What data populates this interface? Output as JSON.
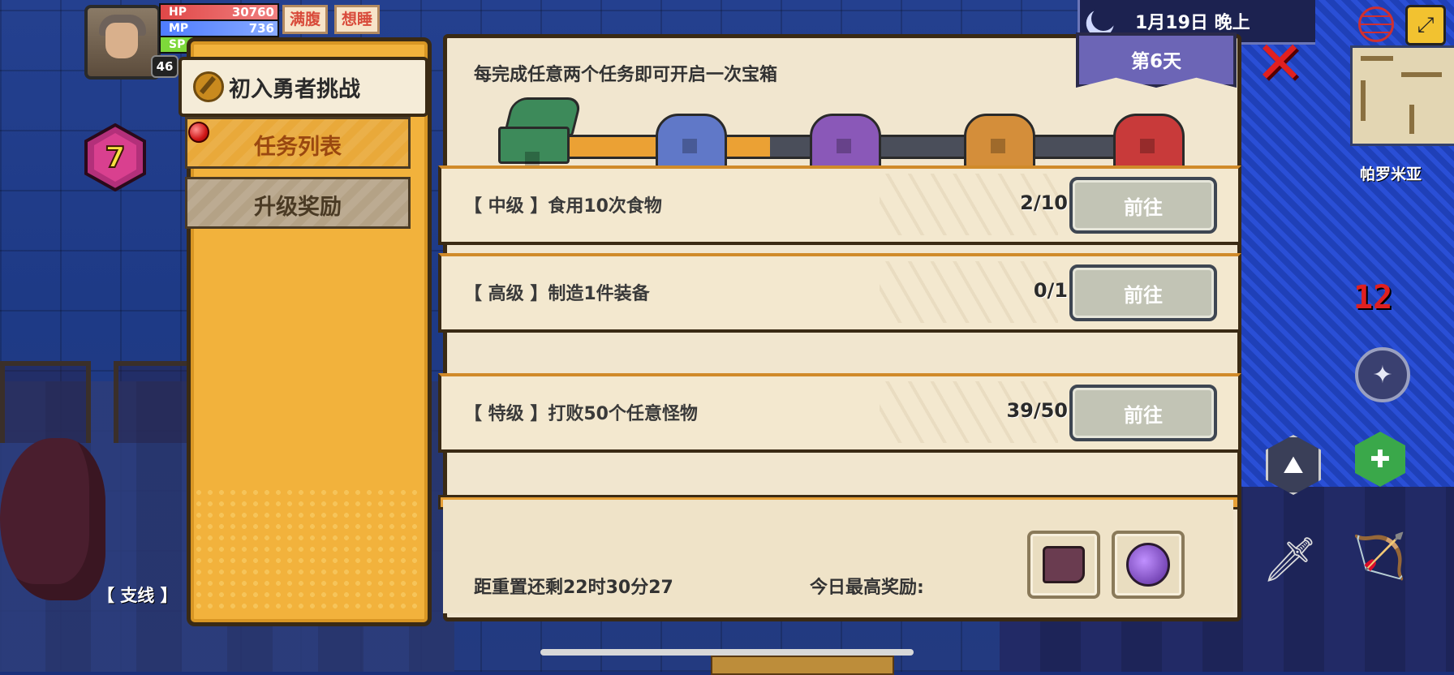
{
  "hud": {
    "hp_label": "HP",
    "hp_value": "30760",
    "mp_label": "MP",
    "mp_value": "736",
    "sp_label": "SP",
    "level": "46",
    "status_full": "满腹",
    "status_sleepy": "想睡",
    "gem_value": "7"
  },
  "top_right": {
    "date_text": "1月19日  晚上",
    "day_banner": "第6天",
    "location": "帕罗米亚",
    "side_number": "12"
  },
  "side_menu": {
    "title": "初入勇者挑战",
    "items": [
      {
        "label": "任务列表",
        "active": true
      },
      {
        "label": "升级奖励",
        "active": false
      }
    ]
  },
  "panel": {
    "header": "每完成任意两个任务即可开启一次宝箱",
    "chest_progress": 0.4,
    "chests": [
      "green",
      "blue",
      "purple",
      "orange",
      "red"
    ],
    "tasks": [
      {
        "title": "【 中级 】食用10次食物",
        "progress": "2/10",
        "button": "前往"
      },
      {
        "title": "【 高级 】制造1件装备",
        "progress": "0/1",
        "button": "前往"
      },
      {
        "title": "【 特级 】打败50个任意怪物",
        "progress": "39/50",
        "button": "前往"
      }
    ],
    "reset_text": "距重置还剩22时30分27",
    "reward_label": "今日最高奖励:"
  },
  "background": {
    "side_quest_tag": "【 支线 】"
  },
  "colors": {
    "menu_orange": "#f2b23c",
    "panel_cream": "#f1e6cf",
    "progress_orange": "#eba134",
    "close_red": "#e02020",
    "day_purple": "#6c65b6"
  },
  "icons": [
    "moon-icon",
    "globe-icon",
    "map-expand-icon",
    "close-icon",
    "shuriken-icon",
    "guild-icon",
    "heal-icon",
    "sword-icon",
    "bow-icon",
    "coin-icon"
  ]
}
